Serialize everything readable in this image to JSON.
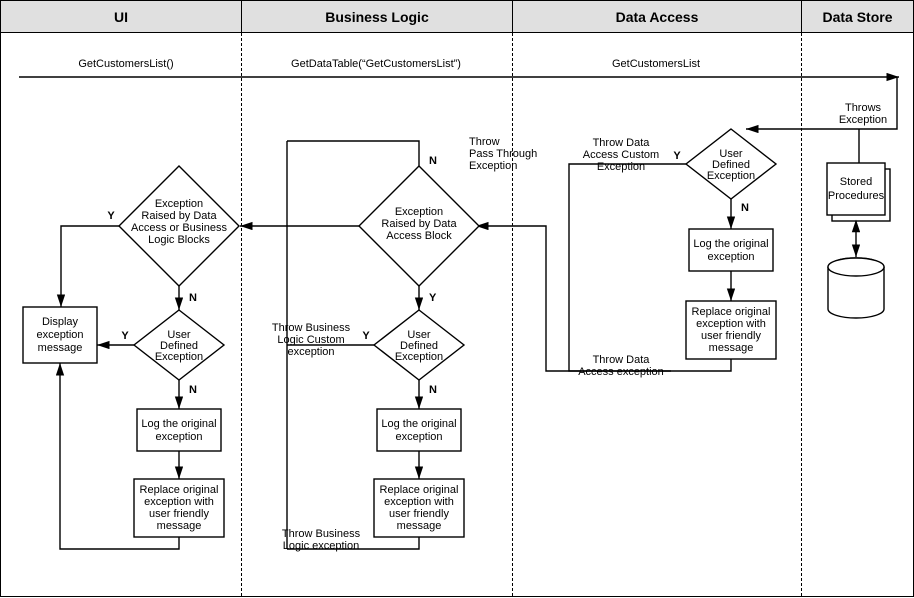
{
  "columns": {
    "ui": "UI",
    "bl": "Business Logic",
    "da": "Data Access",
    "ds": "Data Store"
  },
  "calls": {
    "c1": "GetCustomersList()",
    "c2": "GetDataTable(“GetCustomersList”)",
    "c3": "GetCustomersList"
  },
  "ds": {
    "throws": "Throws",
    "exception": "Exception",
    "stored": "Stored",
    "procedures": "Procedures"
  },
  "da": {
    "throwCustom1": "Throw Data",
    "throwCustom2": "Access Custom",
    "throwCustom3": "Exception",
    "ude1": "User",
    "ude2": "Defined",
    "ude3": "Exception",
    "log1": "Log the original",
    "log2": "exception",
    "rep1": "Replace original",
    "rep2": "exception with",
    "rep3": "user friendly",
    "rep4": "message",
    "throwEx1": "Throw Data",
    "throwEx2": "Access exception"
  },
  "bl": {
    "passThru1": "Throw",
    "passThru2": "Pass Through",
    "passThru3": "Exception",
    "d1a": "Exception",
    "d1b": "Raised by Data",
    "d1c": "Access Block",
    "ude1": "User",
    "ude2": "Defined",
    "ude3": "Exception",
    "throwCustom1": "Throw Business",
    "throwCustom2": "Logic Custom",
    "throwCustom3": "exception",
    "log1": "Log the original",
    "log2": "exception",
    "rep1": "Replace original",
    "rep2": "exception with",
    "rep3": "user friendly",
    "rep4": "message",
    "throwEx1": "Throw Business",
    "throwEx2": "Logic exception"
  },
  "ui": {
    "d1a": "Exception",
    "d1b": "Raised by Data",
    "d1c": "Access or Business",
    "d1d": "Logic Blocks",
    "ude1": "User",
    "ude2": "Defined",
    "ude3": "Exception",
    "disp1": "Display",
    "disp2": "exception",
    "disp3": "message",
    "log1": "Log the original",
    "log2": "exception",
    "rep1": "Replace original",
    "rep2": "exception with",
    "rep3": "user friendly",
    "rep4": "message"
  },
  "yn": {
    "y": "Y",
    "n": "N"
  }
}
